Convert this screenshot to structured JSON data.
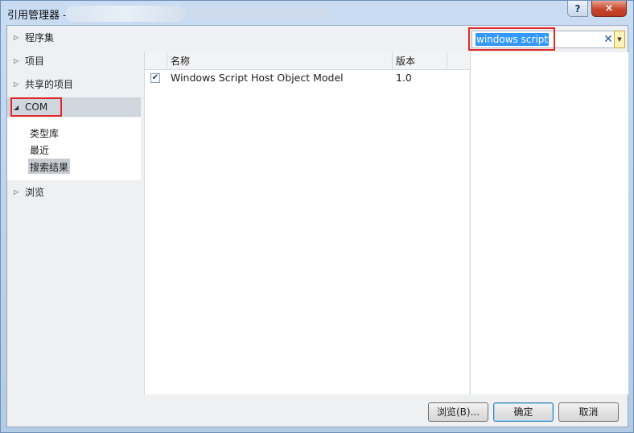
{
  "window": {
    "title": "引用管理器 -",
    "close_label": "×",
    "help_label": "?"
  },
  "nav": {
    "items": [
      {
        "label": "程序集",
        "arrow": "▷"
      },
      {
        "label": "项目",
        "arrow": "▷"
      },
      {
        "label": "共享的项目",
        "arrow": "▷"
      },
      {
        "label": "COM",
        "arrow": "◢"
      },
      {
        "label": "浏览",
        "arrow": "▷"
      }
    ],
    "com_children": [
      "类型库",
      "最近",
      "搜索结果"
    ]
  },
  "search": {
    "value": "windows script",
    "clear": "✕",
    "dropdown": "▼"
  },
  "list": {
    "columns": [
      "名称",
      "版本"
    ],
    "rows": [
      {
        "checked": "✔",
        "name": "Windows Script Host Object Model",
        "version": "1.0"
      }
    ]
  },
  "buttons": {
    "browse": "浏览(B)...",
    "ok": "确定",
    "cancel": "取消"
  },
  "colors": {
    "highlight_box": "#e0262a",
    "selection": "#3399ff"
  }
}
